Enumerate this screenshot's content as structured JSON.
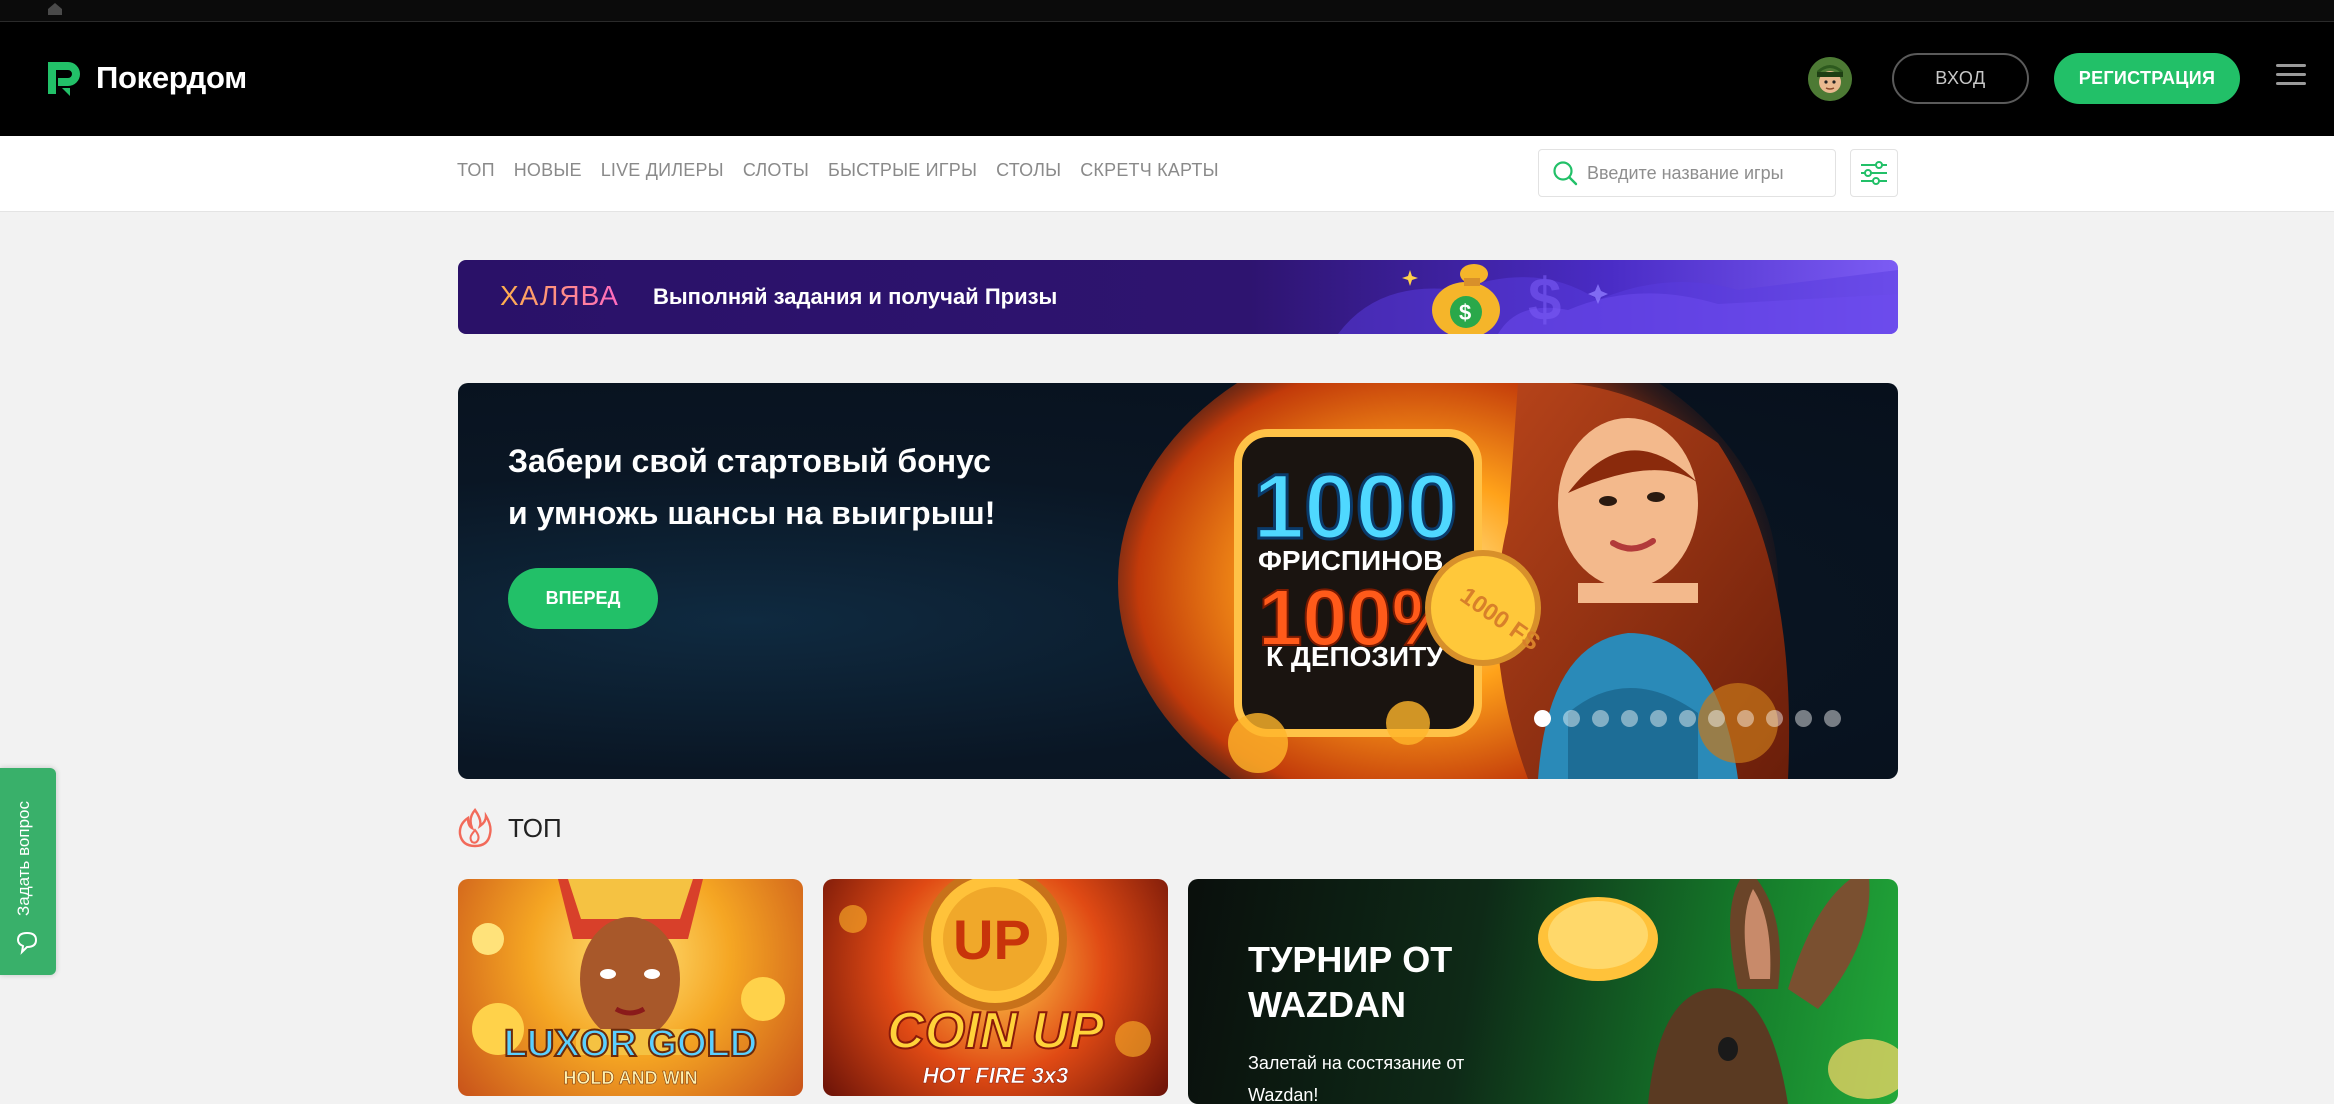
{
  "brand": {
    "name": "Покердом",
    "accent": "#22c068"
  },
  "header": {
    "login_label": "ВХОД",
    "register_label": "РЕГИСТРАЦИЯ"
  },
  "nav": {
    "items": [
      "ТОП",
      "НОВЫЕ",
      "LIVE ДИЛЕРЫ",
      "СЛОТЫ",
      "БЫСТРЫЕ ИГРЫ",
      "СТОЛЫ",
      "СКРЕТЧ КАРТЫ"
    ],
    "search_placeholder": "Введите название игры"
  },
  "promo": {
    "title": "ХАЛЯВА",
    "text": "Выполняй задания и получай Призы"
  },
  "hero": {
    "title_line1": "Забери свой стартовый бонус",
    "title_line2": "и умножь шансы на выигрыш!",
    "button_label": "ВПЕРЕД",
    "offer_amount": "1000",
    "offer_unit": "ФРИСПИНОВ",
    "offer_percent": "100%",
    "offer_suffix": "К ДЕПОЗИТУ",
    "coin_text": "1000 FS",
    "slides_total": 11,
    "slide_active": 1
  },
  "section_top": {
    "title": "ТОП"
  },
  "tiles": [
    {
      "title": "LUXOR GOLD",
      "subtitle": "HOLD AND WIN"
    },
    {
      "title": "COIN UP",
      "subtitle": "HOT FIRE 3x3"
    },
    {
      "title_line1": "ТУРНИР ОТ",
      "title_line2": "WAZDAN",
      "text": "Залетай на состязание от Wazdan!"
    }
  ],
  "support": {
    "label": "Задать вопрос"
  }
}
